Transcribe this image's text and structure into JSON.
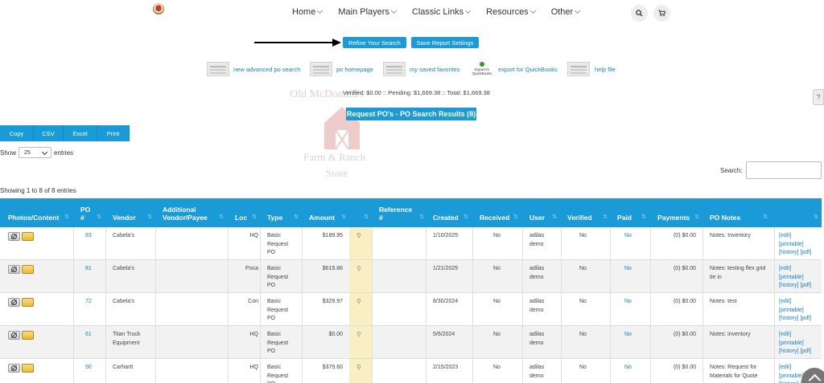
{
  "nav": {
    "items": [
      {
        "label": "Home"
      },
      {
        "label": "Main Players"
      },
      {
        "label": "Classic Links"
      },
      {
        "label": "Resources"
      },
      {
        "label": "Other"
      }
    ]
  },
  "top_buttons": {
    "refine": "Refine Your Search",
    "save": "Save Report Settings"
  },
  "links": {
    "advanced": "new advanced po search",
    "homepage": "po homepage",
    "favorites": "my saved favorites",
    "qb_icon_text": "Export to QuickBooks",
    "quickbooks": "export for QuickBooks",
    "help": "help file"
  },
  "totals": "Verified: $0.00 :: Pending: $1,669.38 :: Total: $1,669.38",
  "help_tab": "?",
  "results_title": "Request PO's - PO Search Results (8)",
  "watermark": {
    "line1": "Old McDonald's",
    "line2": "Farm & Ranch",
    "line3": "Store"
  },
  "export_buttons": [
    "Copy",
    "CSV",
    "Excel",
    "Print"
  ],
  "show": {
    "prefix": "Show",
    "value": "25",
    "suffix": "entries"
  },
  "search": {
    "label": "Search:",
    "value": ""
  },
  "showing": "Showing 1 to 8 of 8 entries",
  "columns": [
    "Photos/Content",
    "PO #",
    "Vendor",
    "Additional Vendor/Payee",
    "Loc",
    "Type",
    "Amount",
    "",
    "Reference #",
    "Created",
    "Received",
    "User",
    "Verified",
    "Paid",
    "Payments",
    "PO Notes",
    ""
  ],
  "rows": [
    {
      "po": "83",
      "vendor": "Cabela's",
      "loc": "HQ",
      "type": "Basic Request PO",
      "amount": "$189.95",
      "created": "1/10/2025",
      "received": "No",
      "user": "adilas demo",
      "verified": "No",
      "paid": "No",
      "payments": "(0) $0.00",
      "notes": "Notes: Inventory"
    },
    {
      "po": "81",
      "vendor": "Cabela's",
      "loc": "Poca",
      "type": "Basic Request PO",
      "amount": "$619.86",
      "created": "1/21/2025",
      "received": "No",
      "user": "adilas demo",
      "verified": "No",
      "paid": "No",
      "payments": "(0) $0.00",
      "notes": "Notes: testing flex grid tie in"
    },
    {
      "po": "72",
      "vendor": "Cabela's",
      "loc": "Con",
      "type": "Basic Request PO",
      "amount": "$329.97",
      "created": "8/30/2024",
      "received": "No",
      "user": "adilas demo",
      "verified": "No",
      "paid": "No",
      "payments": "(0) $0.00",
      "notes": "Notes: test"
    },
    {
      "po": "61",
      "vendor": "Titan Truck Equipment",
      "loc": "HQ",
      "type": "Basic Request PO",
      "amount": "$0.00",
      "created": "5/6/2024",
      "received": "No",
      "user": "adilas demo",
      "verified": "No",
      "paid": "No",
      "payments": "(0) $0.00",
      "notes": "Notes: inventory"
    },
    {
      "po": "50",
      "vendor": "Carhartt",
      "loc": "HQ",
      "type": "Basic Request PO",
      "amount": "$379.60",
      "created": "2/15/2023",
      "received": "No",
      "user": "adilas demo",
      "verified": "No",
      "paid": "No",
      "payments": "(0) $0.00",
      "notes": "Notes: Request for Materials for Quote"
    }
  ],
  "actions": {
    "edit": "[edit]",
    "printable": "[printable]",
    "history": "[history] [pdf]"
  },
  "colors": {
    "accent": "#1a9ad6",
    "link": "#1a7fc0",
    "highlight": "#f8f0c2"
  }
}
